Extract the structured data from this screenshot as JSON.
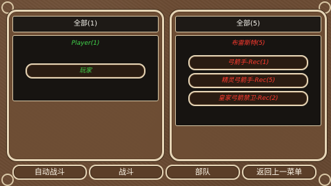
{
  "left_panel": {
    "header": "全部(1)",
    "list_title": "Player(1)",
    "items": [
      "玩家"
    ]
  },
  "right_panel": {
    "header": "全部(5)",
    "list_title": "布雷斯特(5)",
    "items": [
      "弓箭手-Rec(1)",
      "精灵弓箭手-Rec(5)",
      "皇家弓箭禁卫-Rec(2)"
    ]
  },
  "buttons": {
    "auto_battle": "自动战斗",
    "battle": "战斗",
    "troops": "部队",
    "back": "返回上一菜单"
  },
  "colors": {
    "player_text": "#41d34b",
    "enemy_text": "#ff3b2f",
    "frame": "#e6d5b6",
    "background": "#6b4b33"
  }
}
